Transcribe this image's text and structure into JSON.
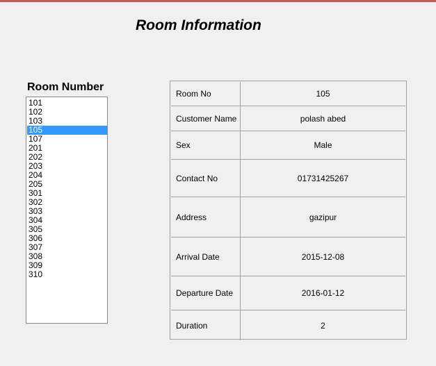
{
  "title": "Room Information",
  "room_list": {
    "label": "Room Number",
    "items": [
      "101",
      "102",
      "103",
      "105",
      "107",
      "201",
      "202",
      "203",
      "204",
      "205",
      "301",
      "302",
      "303",
      "304",
      "305",
      "306",
      "307",
      "308",
      "309",
      "310"
    ],
    "selected": "105"
  },
  "info": {
    "rows": [
      {
        "label": "Room No",
        "value": "105"
      },
      {
        "label": "Customer Name",
        "value": "polash abed"
      },
      {
        "label": "Sex",
        "value": "Male"
      },
      {
        "label": "Contact No",
        "value": "01731425267"
      },
      {
        "label": "Address",
        "value": "gazipur"
      },
      {
        "label": "Arrival Date",
        "value": "2015-12-08"
      },
      {
        "label": "Departure Date",
        "value": "2016-01-12"
      },
      {
        "label": "Duration",
        "value": "2"
      }
    ]
  },
  "colors": {
    "selection": "#3399ff",
    "window_top_border": "#c85a5a",
    "background": "#f0f0f0"
  }
}
